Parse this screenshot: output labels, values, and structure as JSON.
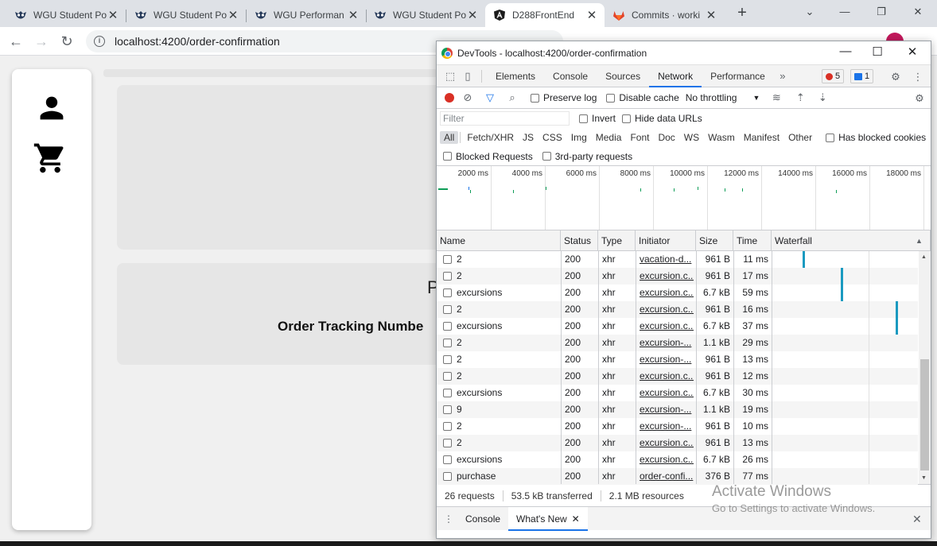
{
  "browser": {
    "tabs": [
      {
        "title": "WGU Student Po",
        "icon": "wgu-owl-icon"
      },
      {
        "title": "WGU Student Po",
        "icon": "wgu-owl-icon"
      },
      {
        "title": "WGU Performan",
        "icon": "wgu-owl-icon"
      },
      {
        "title": "WGU Student Po",
        "icon": "wgu-owl-icon"
      },
      {
        "title": "D288FrontEnd",
        "icon": "angular-icon",
        "active": true
      },
      {
        "title": "Commits · worki",
        "icon": "gitlab-icon"
      }
    ],
    "url": "localhost:4200/order-confirmation"
  },
  "page": {
    "heading_partial": "P",
    "tracking_label": "Order Tracking Numbe"
  },
  "devtools": {
    "title": "DevTools - localhost:4200/order-confirmation",
    "tabs": [
      "Elements",
      "Console",
      "Sources",
      "Network",
      "Performance"
    ],
    "active_tab": "Network",
    "errors": "5",
    "messages": "1",
    "controls": {
      "preserve_log": "Preserve log",
      "disable_cache": "Disable cache",
      "throttling": "No throttling"
    },
    "filter": {
      "placeholder": "Filter",
      "invert": "Invert",
      "hide_data_urls": "Hide data URLs"
    },
    "types": [
      "All",
      "Fetch/XHR",
      "JS",
      "CSS",
      "Img",
      "Media",
      "Font",
      "Doc",
      "WS",
      "Wasm",
      "Manifest",
      "Other"
    ],
    "has_blocked_cookies": "Has blocked cookies",
    "blocked_requests": "Blocked Requests",
    "third_party": "3rd-party requests",
    "timeline_ticks": [
      "2000 ms",
      "4000 ms",
      "6000 ms",
      "8000 ms",
      "10000 ms",
      "12000 ms",
      "14000 ms",
      "16000 ms",
      "18000 ms"
    ],
    "columns": [
      "Name",
      "Status",
      "Type",
      "Initiator",
      "Size",
      "Time",
      "Waterfall"
    ],
    "rows": [
      {
        "name": "2",
        "status": "200",
        "type": "xhr",
        "initiator": "vacation-d...",
        "size": "961 B",
        "time": "11 ms",
        "wf": 0.13
      },
      {
        "name": "2",
        "status": "200",
        "type": "xhr",
        "initiator": "excursion.c...",
        "size": "961 B",
        "time": "17 ms",
        "wf": 0.29
      },
      {
        "name": "excursions",
        "status": "200",
        "type": "xhr",
        "initiator": "excursion.c...",
        "size": "6.7 kB",
        "time": "59 ms",
        "wf": 0.29
      },
      {
        "name": "2",
        "status": "200",
        "type": "xhr",
        "initiator": "excursion.c...",
        "size": "961 B",
        "time": "16 ms",
        "wf": 0.52
      },
      {
        "name": "excursions",
        "status": "200",
        "type": "xhr",
        "initiator": "excursion.c...",
        "size": "6.7 kB",
        "time": "37 ms",
        "wf": 0.52
      },
      {
        "name": "2",
        "status": "200",
        "type": "xhr",
        "initiator": "excursion-...",
        "size": "1.1 kB",
        "time": "29 ms",
        "wf": 0.62
      },
      {
        "name": "2",
        "status": "200",
        "type": "xhr",
        "initiator": "excursion-...",
        "size": "961 B",
        "time": "13 ms",
        "wf": 0.62
      },
      {
        "name": "2",
        "status": "200",
        "type": "xhr",
        "initiator": "excursion.c...",
        "size": "961 B",
        "time": "12 ms",
        "wf": 0.68
      },
      {
        "name": "excursions",
        "status": "200",
        "type": "xhr",
        "initiator": "excursion.c...",
        "size": "6.7 kB",
        "time": "30 ms",
        "wf": 0.68
      },
      {
        "name": "9",
        "status": "200",
        "type": "xhr",
        "initiator": "excursion-...",
        "size": "1.1 kB",
        "time": "19 ms",
        "wf": 0.77
      },
      {
        "name": "2",
        "status": "200",
        "type": "xhr",
        "initiator": "excursion-...",
        "size": "961 B",
        "time": "10 ms",
        "wf": 0.77
      },
      {
        "name": "2",
        "status": "200",
        "type": "xhr",
        "initiator": "excursion.c...",
        "size": "961 B",
        "time": "13 ms",
        "wf": 0.83
      },
      {
        "name": "excursions",
        "status": "200",
        "type": "xhr",
        "initiator": "excursion.c...",
        "size": "6.7 kB",
        "time": "26 ms",
        "wf": 0.83
      },
      {
        "name": "purchase",
        "status": "200",
        "type": "xhr",
        "initiator": "order-confi...",
        "size": "376 B",
        "time": "77 ms",
        "wf": null
      }
    ],
    "summary": {
      "requests": "26 requests",
      "transferred": "53.5 kB transferred",
      "resources": "2.1 MB resources"
    },
    "drawer": {
      "console": "Console",
      "whats_new": "What's New"
    }
  },
  "watermark": {
    "line1": "Activate Windows",
    "line2": "Go to Settings to activate Windows."
  }
}
